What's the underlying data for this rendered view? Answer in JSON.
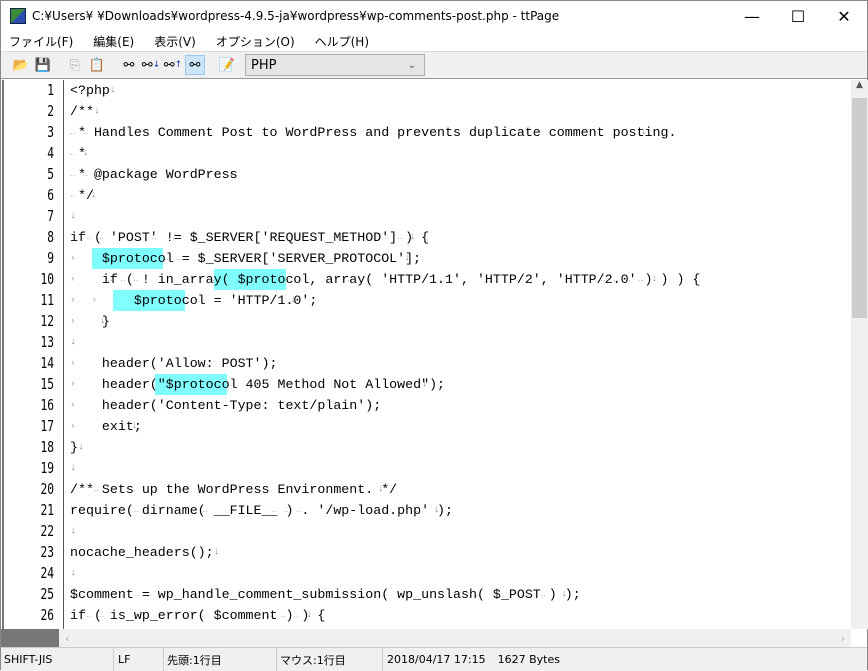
{
  "window": {
    "title": "C:¥Users¥      ¥Downloads¥wordpress-4.9.5-ja¥wordpress¥wp-comments-post.php - ttPage",
    "minimize": "—",
    "maximize": "☐",
    "close": "✕"
  },
  "menu": [
    "ファイル(F)",
    "編集(E)",
    "表示(V)",
    "オプション(O)",
    "ヘルプ(H)"
  ],
  "toolbar": {
    "icons": [
      "open-folder-icon",
      "save-icon",
      "copy-icon",
      "paste-icon",
      "find-icon",
      "find-next-icon",
      "find-previous-icon",
      "find-highlight-icon",
      "edit-icon"
    ],
    "language": "PHP"
  },
  "editor": {
    "highlight": "$protocol",
    "highlight_color": "#80ffff",
    "lines": [
      "<?php",
      "/**",
      " * Handles Comment Post to WordPress and prevents duplicate comment posting.",
      " *",
      " * @package WordPress",
      " */",
      "",
      "if ( 'POST' != $_SERVER['REQUEST_METHOD'] ) {",
      "\t$protocol = $_SERVER['SERVER_PROTOCOL'];",
      "\tif ( ! in_array( $protocol, array( 'HTTP/1.1', 'HTTP/2', 'HTTP/2.0' ) ) ) {",
      "\t\t$protocol = 'HTTP/1.0';",
      "\t}",
      "",
      "\theader('Allow: POST');",
      "\theader(\"$protocol 405 Method Not Allowed\");",
      "\theader('Content-Type: text/plain');",
      "\texit;",
      "}",
      "",
      "/** Sets up the WordPress Environment. */",
      "require( dirname( __FILE__ ) . '/wp-load.php' );",
      "",
      "nocache_headers();",
      "",
      "$comment = wp_handle_comment_submission( wp_unslash( $_POST ) );",
      "if ( is_wp_error( $comment ) ) {"
    ]
  },
  "status": {
    "encoding": "SHIFT-JIS",
    "eol": "LF",
    "top": "先頭:1行目",
    "mouse": "マウス:1行目",
    "datetime": "2018/04/17 17:15",
    "size": "1627 Bytes"
  }
}
